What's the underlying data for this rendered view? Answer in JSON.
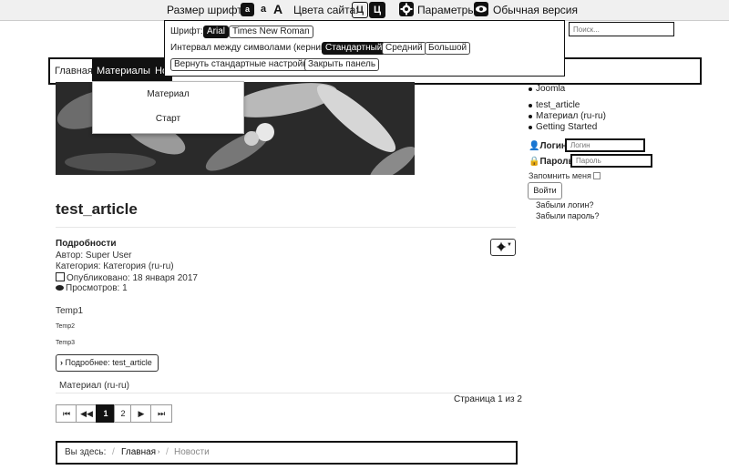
{
  "topbar": {
    "font_size_label": "Размер шрифта:",
    "font_small": "a",
    "font_medium": "a",
    "font_large": "A",
    "colors_label": "Цвета сайта:",
    "color_light": "Ц",
    "color_dark": "Ц",
    "settings_label": "Параметры",
    "normal_version_label": "Обычная версия"
  },
  "popup": {
    "font_label": "Шрифт:",
    "font_options": [
      "Arial",
      "Times New Roman"
    ],
    "font_selected": "Arial",
    "spacing_label": "Интервал между символами (кернинг):",
    "spacing_options": [
      "Стандартный",
      "Средний",
      "Большой"
    ],
    "spacing_selected": "Стандартный",
    "reset_label": "Вернуть стандартные настройки",
    "close_label": "Закрыть панель"
  },
  "search": {
    "placeholder": "Поиск..."
  },
  "nav": {
    "items": [
      "Главная",
      "Материалы",
      "Но"
    ],
    "dropdown": [
      "Материал",
      "Старт"
    ]
  },
  "article": {
    "title": "test_article",
    "details_heading": "Подробности",
    "author": "Автор: Super User",
    "category": "Категория: Категория (ru-ru)",
    "published": "Опубликовано: 18 января 2017",
    "views": "Просмотров: 1",
    "body": [
      "Temp1",
      "Temp2",
      "Temp3"
    ],
    "readmore": "Подробнее: test_article",
    "category_link": "Материал (ru-ru)",
    "page_counter": "Страница 1 из 2"
  },
  "pagination": {
    "items": [
      "⏮",
      "◀◀",
      "1",
      "2",
      "▶",
      "⏭"
    ],
    "current": "1"
  },
  "breadcrumb": {
    "label": "Вы здесь:",
    "home": "Главная",
    "current": "Новости"
  },
  "sidebar": {
    "list1": [
      "Joomla"
    ],
    "list2": [
      "test_article",
      "Материал (ru-ru)",
      "Getting Started"
    ],
    "login_label": "Логин",
    "login_placeholder": "Логин",
    "password_label": "Пароль",
    "password_placeholder": "Пароль",
    "remember": "Запомнить меня",
    "submit": "Войти",
    "forgot_login": "Забыли логин?",
    "forgot_password": "Забыли пароль?"
  }
}
